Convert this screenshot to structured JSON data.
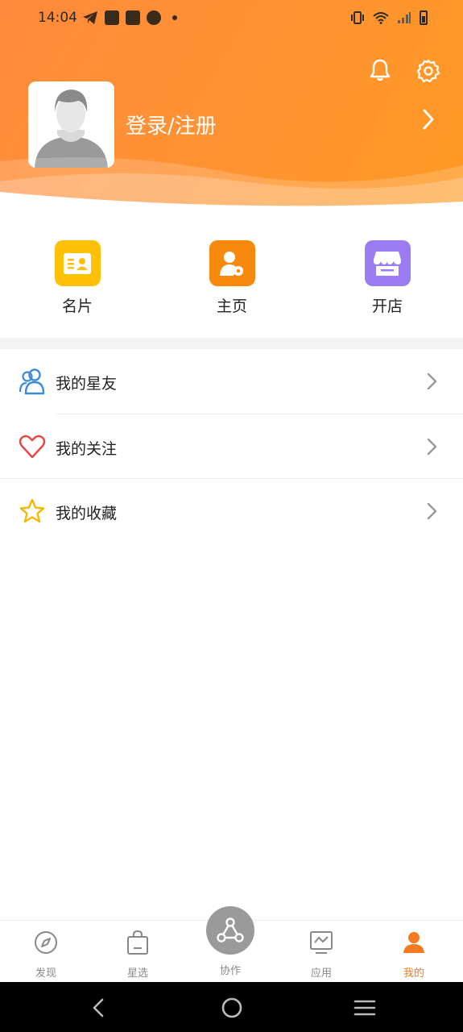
{
  "status_bar": {
    "time": "14:04"
  },
  "header": {
    "login_text": "登录/注册",
    "icons": [
      "bell-icon",
      "gear-icon",
      "chevron-right-icon"
    ]
  },
  "quick_actions": [
    {
      "label": "名片",
      "icon": "business-card-icon",
      "color": "#ffc107"
    },
    {
      "label": "主页",
      "icon": "user-settings-icon",
      "color": "#f7890f"
    },
    {
      "label": "开店",
      "icon": "store-icon",
      "color": "#9b7cf2"
    }
  ],
  "menu": [
    {
      "label": "我的星友",
      "icon": "friends-icon",
      "color": "#3d8bd9"
    },
    {
      "label": "我的关注",
      "icon": "heart-icon",
      "color": "#e84545"
    },
    {
      "label": "我的收藏",
      "icon": "star-icon",
      "color": "#f5b800"
    }
  ],
  "tabbar": {
    "tabs": [
      {
        "label": "发现",
        "icon": "compass-icon"
      },
      {
        "label": "星选",
        "icon": "shopping-bag-icon"
      },
      {
        "label": "协作",
        "icon": "network-icon"
      },
      {
        "label": "应用",
        "icon": "monitor-chart-icon"
      },
      {
        "label": "我的",
        "icon": "person-icon",
        "active": true
      }
    ],
    "active_color": "#f47b20"
  }
}
